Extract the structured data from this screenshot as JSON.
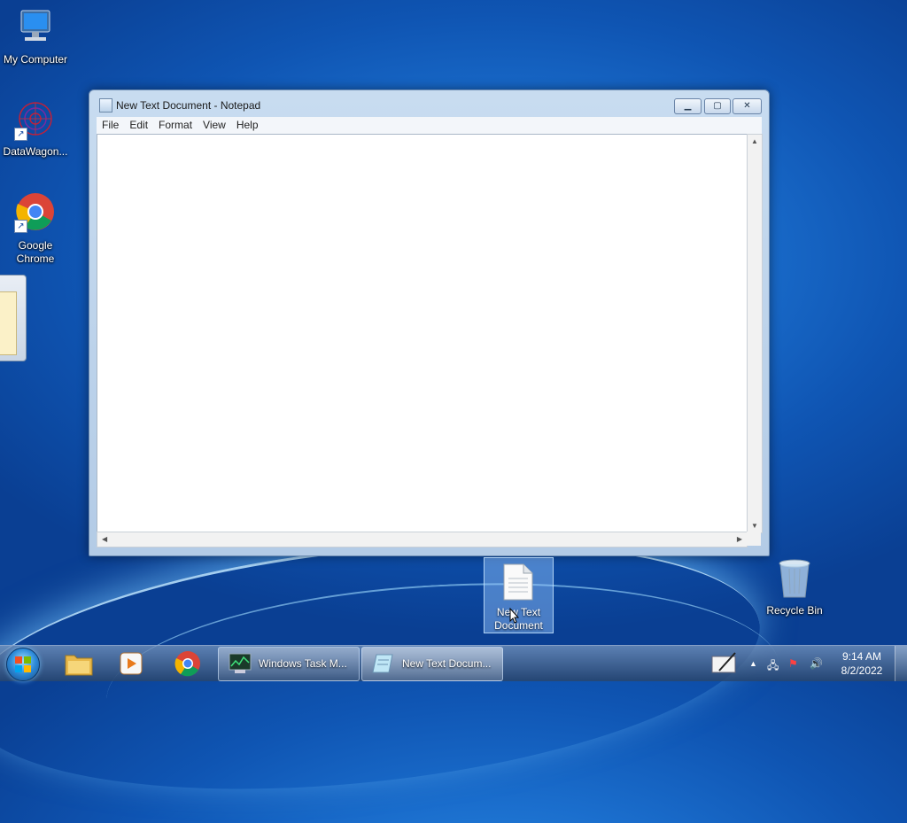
{
  "desktop": {
    "icons": [
      {
        "label": "My Computer"
      },
      {
        "label": "DataWagon..."
      },
      {
        "label": "Google Chrome"
      },
      {
        "label": "New Text Document"
      },
      {
        "label": "Recycle Bin"
      }
    ]
  },
  "notepad": {
    "title": "New Text Document - Notepad",
    "menu": [
      "File",
      "Edit",
      "Format",
      "View",
      "Help"
    ],
    "content": ""
  },
  "taskbar": {
    "buttons": [
      {
        "label": "Windows Task M..."
      },
      {
        "label": "New Text Docum..."
      }
    ],
    "clock": {
      "time": "9:14 AM",
      "date": "8/2/2022"
    }
  },
  "colors": {
    "accent": "#1b6fce",
    "titlebar": "#c8dcf0"
  }
}
